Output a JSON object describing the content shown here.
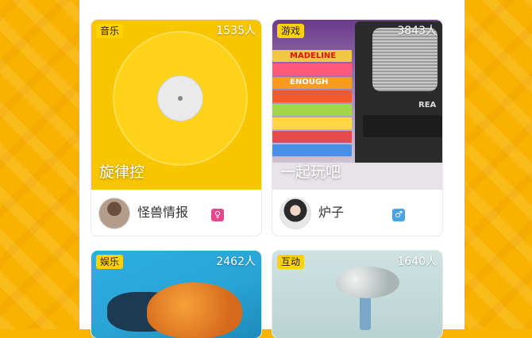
{
  "cards": [
    {
      "category": "音乐",
      "count": "1535人",
      "title": "旋律控",
      "host": "怪兽情报",
      "gender_icon": "female-icon",
      "gender_color": "#e8468c"
    },
    {
      "category": "游戏",
      "count": "3843人",
      "title": "一起玩吧",
      "host": "炉子",
      "gender_icon": "male-icon",
      "gender_color": "#4aa3e6",
      "cover_words": [
        "MADELINE",
        "ENOUGH",
        "REA"
      ]
    },
    {
      "category": "娱乐",
      "count": "2462人"
    },
    {
      "category": "互动",
      "count": "1640人"
    }
  ],
  "colors": {
    "background": "#f8b300",
    "tag": "#ffd200"
  }
}
